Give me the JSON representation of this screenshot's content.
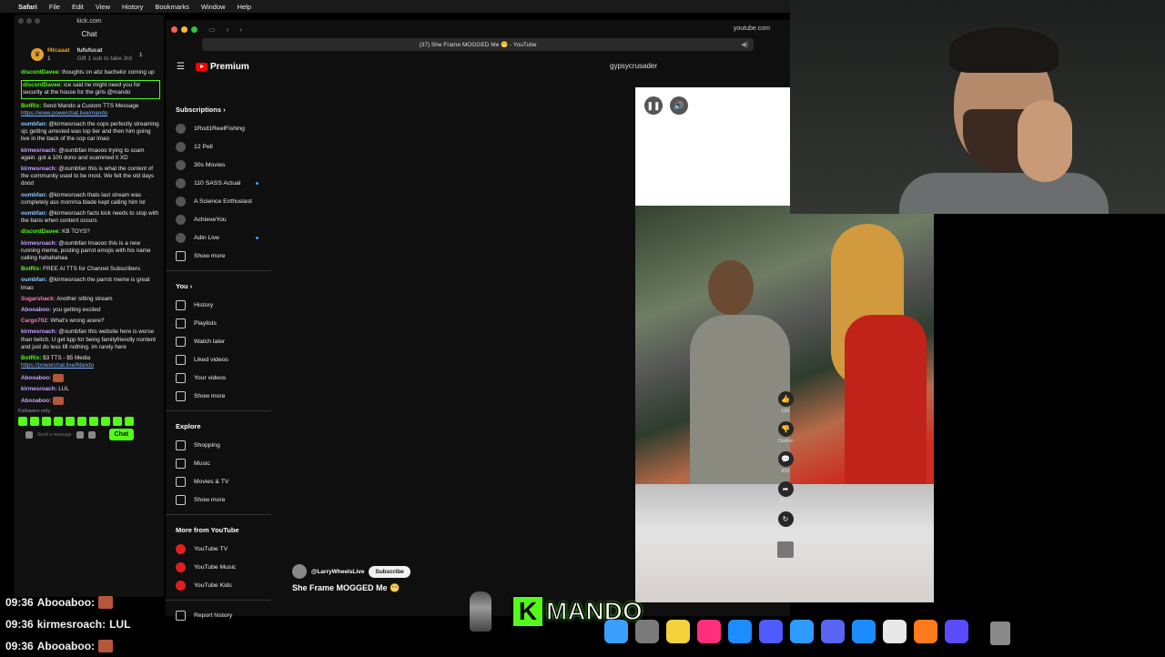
{
  "menubar": {
    "apple": "",
    "items": [
      "Safari",
      "File",
      "Edit",
      "View",
      "History",
      "Bookmarks",
      "Window",
      "Help"
    ]
  },
  "chat": {
    "window_title": "kick.com",
    "title": "Chat",
    "leader": {
      "name": "f4tcaaat",
      "count": "1",
      "gift_user": "fufufucat",
      "gift_count": "1",
      "gift_text": "Gift 1 sub to take 3rd"
    },
    "messages": [
      {
        "user": "discordDavee:",
        "text": " thoughts on abz bachelor coming up",
        "color": "green"
      },
      {
        "user": "discordDavee:",
        "text": " ice said he might need you for security at the house for the girls @mando",
        "color": "green",
        "hl": true
      },
      {
        "user": "BotRix:",
        "text": " Send Mando a Custom TTS Message ",
        "link": "https://www.powerchat.live/mando",
        "color": "green"
      },
      {
        "user": "oumbfan:",
        "text": " @kirmesroach the cops perfectly streaming sjc getting arrested was top tier and then him going live in the back of the cop car lmao",
        "color": "blue"
      },
      {
        "user": "kirmesroach:",
        "text": " @oumbfan lmaooo trying to scam again. got a 100 dono and scammed it XD",
        "color": "purple"
      },
      {
        "user": "kirmesroach:",
        "text": " @oumbfan this is what the content of the community used to be most. We felt the old days dood",
        "color": "purple"
      },
      {
        "user": "oumbfan:",
        "text": " @kirmesroach thats last stream was completely ass momma blade kept calling him lol",
        "color": "blue"
      },
      {
        "user": "oumbfan:",
        "text": " @kirmesroach facts kick needs to stop with the bans when content occurs",
        "color": "blue"
      },
      {
        "user": "discordDavee:",
        "text": " KB TOYS?",
        "color": "green"
      },
      {
        "user": "kirmesroach:",
        "text": " @oumbfan lmaooo this is a new running meme, posting parrot emojis with his name calling hahahahaa",
        "color": "purple"
      },
      {
        "user": "BotRix:",
        "text": " FREE AI TTS for Channel Subscribers",
        "color": "green"
      },
      {
        "user": "oumbfan:",
        "text": " @kirmesroach the parrot meme is great lmao",
        "color": "blue"
      },
      {
        "user": "Sugarshack:",
        "text": " Another sitting stream",
        "color": "pink"
      },
      {
        "user": "Abooaboo:",
        "text": " you getting excited",
        "color": "purple"
      },
      {
        "user": "Cargo702:",
        "text": " What's wrong acere?",
        "color": "pink"
      },
      {
        "user": "kirmesroach:",
        "text": " @oumbfan this website here is worse than twitch. U get kpp for being familyfriendly nontent and just do less till nothing. im rarely here",
        "color": "purple"
      },
      {
        "user": "BotRix:",
        "text": " $3 TTS - $5 Media ",
        "link": "https://powerchat.live/Mando",
        "color": "green"
      },
      {
        "user": "Abooaboo:",
        "text": " ",
        "emote": true,
        "color": "purple"
      },
      {
        "user": "kirmesroach:",
        "text": " LUL",
        "color": "purple"
      },
      {
        "user": "Abooaboo:",
        "text": " ",
        "emote": true,
        "color": "purple"
      }
    ],
    "followers_only": "Followers only",
    "send_button": "Chat",
    "input_placeholder": "Send a message"
  },
  "overlay": [
    {
      "time": "09:36",
      "user": "Abooaboo:",
      "text": "",
      "emote": true
    },
    {
      "time": "09:36",
      "user": "kirmesroach:",
      "text": "LUL",
      "emote": false
    },
    {
      "time": "09:36",
      "user": "Abooaboo:",
      "text": "",
      "emote": true
    }
  ],
  "browser": {
    "url": "youtube.com",
    "tab_title": "(37) She Frame MOGGED Me 😬 - YouTube",
    "logo": "Premium",
    "channel_top": "gypsycrusader",
    "sidebar": {
      "subscriptions_label": "Subscriptions",
      "subscriptions": [
        "1Rod1ReelFishing",
        "12 Pell",
        "30s Movies",
        "110 SASS Actual",
        "A Science Enthusiast",
        "AchieveYou",
        "Adin Live"
      ],
      "show_more": "Show more",
      "you_label": "You",
      "you_items": [
        "History",
        "Playlists",
        "Watch later",
        "Liked videos",
        "Your videos"
      ],
      "explore_label": "Explore",
      "explore_items": [
        "Shopping",
        "Music",
        "Movies & TV"
      ],
      "more_label": "More from YouTube",
      "more_items": [
        "YouTube TV",
        "YouTube Music",
        "YouTube Kids"
      ],
      "report": "Report history"
    },
    "short": {
      "channel": "@LarryWheelsLive",
      "subscribe": "Subscribe",
      "title": "She Frame MOGGED Me 😬",
      "likes": "18K",
      "dislike": "Dislike",
      "comments": "803",
      "share": "Share",
      "remix": "Remix"
    }
  },
  "brand": {
    "letter": "K",
    "name": "MANDO",
    "accent": "#53fc18"
  },
  "dock_colors": [
    "#3aa0ff",
    "#7a7a7a",
    "#f4d23c",
    "#ff2e7a",
    "#1c8cff",
    "#4d5bff",
    "#2e9cff",
    "#5865f2",
    "#1a8cff",
    "#e8e8e8",
    "#ff7a1a",
    "#5a4bff"
  ]
}
